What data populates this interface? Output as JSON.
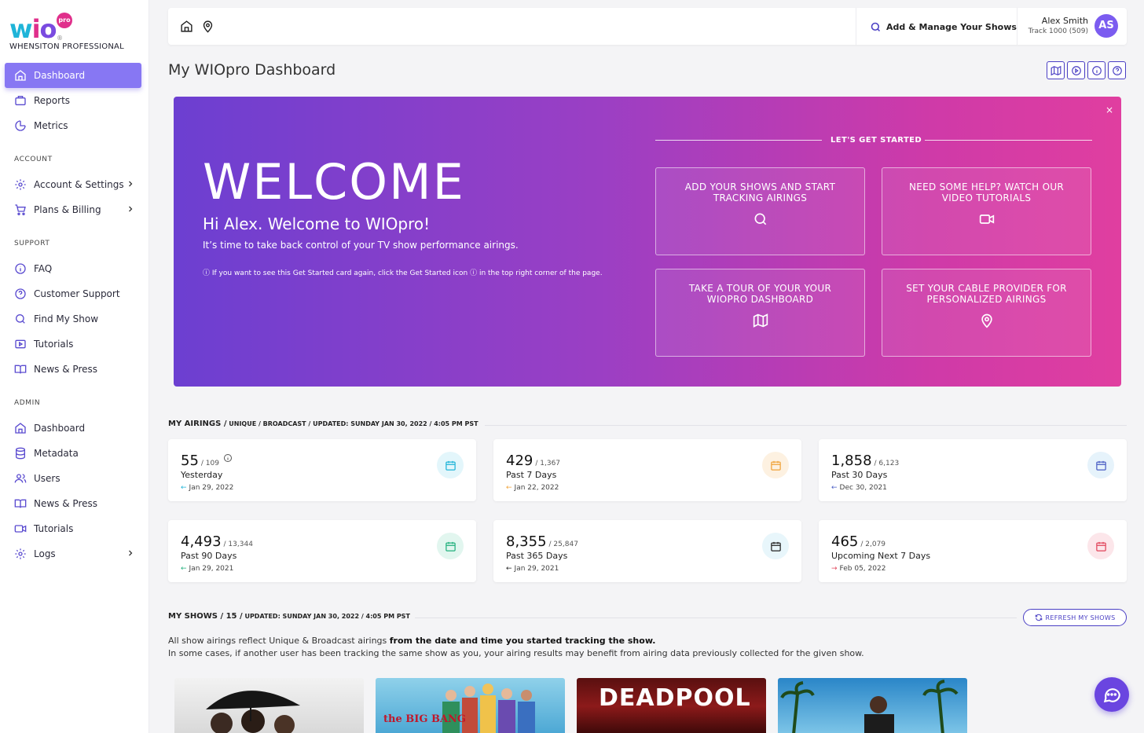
{
  "brand": {
    "logo_w": "w",
    "logo_i": "i",
    "logo_o": "o",
    "logo_pro": "pro",
    "logo_reg": "®",
    "subtitle": "WHENSITON PROFESSIONAL",
    "colors": {
      "accent": "#8777f3",
      "primary": "#4a3fc4",
      "pink": "#e02f8b",
      "cyan": "#1fb4d8"
    }
  },
  "sidebar": {
    "main": [
      {
        "label": "Dashboard",
        "icon": "home-icon",
        "active": true
      },
      {
        "label": "Reports",
        "icon": "briefcase-icon"
      },
      {
        "label": "Metrics",
        "icon": "pie-chart-icon"
      }
    ],
    "account_heading": "ACCOUNT",
    "account": [
      {
        "label": "Account & Settings",
        "icon": "gear-icon",
        "chevron": true
      },
      {
        "label": "Plans & Billing",
        "icon": "cart-icon",
        "chevron": true
      }
    ],
    "support_heading": "SUPPORT",
    "support": [
      {
        "label": "FAQ",
        "icon": "info-icon"
      },
      {
        "label": "Customer Support",
        "icon": "help-circle-icon"
      },
      {
        "label": "Find My Show",
        "icon": "search-icon"
      },
      {
        "label": "Tutorials",
        "icon": "play-icon"
      },
      {
        "label": "News & Press",
        "icon": "book-icon"
      }
    ],
    "admin_heading": "ADMIN",
    "admin": [
      {
        "label": "Dashboard",
        "icon": "home-icon"
      },
      {
        "label": "Metadata",
        "icon": "database-icon"
      },
      {
        "label": "Users",
        "icon": "users-icon"
      },
      {
        "label": "News & Press",
        "icon": "book-icon"
      },
      {
        "label": "Tutorials",
        "icon": "video-icon"
      },
      {
        "label": "Logs",
        "icon": "gear-icon",
        "chevron": true
      }
    ]
  },
  "topbar": {
    "add_label": "Add & Manage Your Shows",
    "user_name": "Alex Smith",
    "user_track": "Track 1000 (509)",
    "avatar_initials": "AS"
  },
  "page": {
    "title": "My WIOpro Dashboard"
  },
  "banner": {
    "close": "×",
    "welcome": "WELCOME",
    "greeting": "Hi Alex. Welcome to WIOpro!",
    "tagline": "It’s time to take back control of your TV show performance airings.",
    "note": "ⓘ If you want to see this Get Started card again, click the Get Started icon ⓘ in the top right corner of the page.",
    "get_started": "LET'S GET STARTED",
    "cards": [
      {
        "text": "ADD YOUR SHOWS AND START TRACKING AIRINGS",
        "icon": "search-icon"
      },
      {
        "text": "NEED SOME HELP? WATCH OUR VIDEO TUTORIALS",
        "icon": "video-icon"
      },
      {
        "text": "TAKE A TOUR OF YOUR YOUR WIOPRO DASHBOARD",
        "icon": "map-icon"
      },
      {
        "text": "SET YOUR CABLE PROVIDER FOR PERSONALIZED AIRINGS",
        "icon": "map-pin-icon"
      }
    ]
  },
  "airings": {
    "heading": "MY AIRINGS /",
    "heading_sub": " UNIQUE / BROADCAST / UPDATED: SUNDAY JAN 30, 2022 / 4:05 PM PST",
    "stats": [
      {
        "value": "55",
        "total": "/ 109",
        "label": "Yesterday",
        "date": "Jan 29, 2022",
        "arrow": "←",
        "color": "#1fb4d8",
        "bg": "#e3f6fb",
        "info": true
      },
      {
        "value": "429",
        "total": "/ 1,367",
        "label": "Past 7 Days",
        "date": "Jan 22, 2022",
        "arrow": "←",
        "color": "#f0a33a",
        "bg": "#fdf1e1"
      },
      {
        "value": "1,858",
        "total": "/ 6,123",
        "label": "Past 30 Days",
        "date": "Dec 30, 2021",
        "arrow": "←",
        "color": "#4a5ec4",
        "bg": "#e6f3fb"
      },
      {
        "value": "4,493",
        "total": "/ 13,344",
        "label": "Past 90 Days",
        "date": "Jan 29, 2021",
        "arrow": "←",
        "color": "#22b07d",
        "bg": "#e2f6ef"
      },
      {
        "value": "8,355",
        "total": "/ 25,847",
        "label": "Past 365 Days",
        "date": "Jan 29, 2021",
        "arrow": "←",
        "color": "#222222",
        "bg": "#e8f6fb"
      },
      {
        "value": "465",
        "total": "/ 2,079",
        "label": "Upcoming Next 7 Days",
        "date": "Feb 05, 2022",
        "arrow": "→",
        "color": "#e0445a",
        "bg": "#fce6ea"
      }
    ]
  },
  "shows": {
    "heading": "MY SHOWS / 15 /",
    "heading_sub": " UPDATED: SUNDAY JAN 30, 2022 / 4:05 PM PST",
    "refresh_label": "REFRESH MY SHOWS",
    "note_1a": "All show airings reflect Unique & Broadcast airings ",
    "note_1b": "from the date and time you started tracking the show.",
    "note_2": "In some cases, if another user has been tracking the same show as you, your airing results may benefit from airing data previously collected for the given show.",
    "posters": [
      {
        "title": ""
      },
      {
        "title": "the BIG BANG"
      },
      {
        "title": "DEADPOOL"
      },
      {
        "title": ""
      }
    ]
  }
}
